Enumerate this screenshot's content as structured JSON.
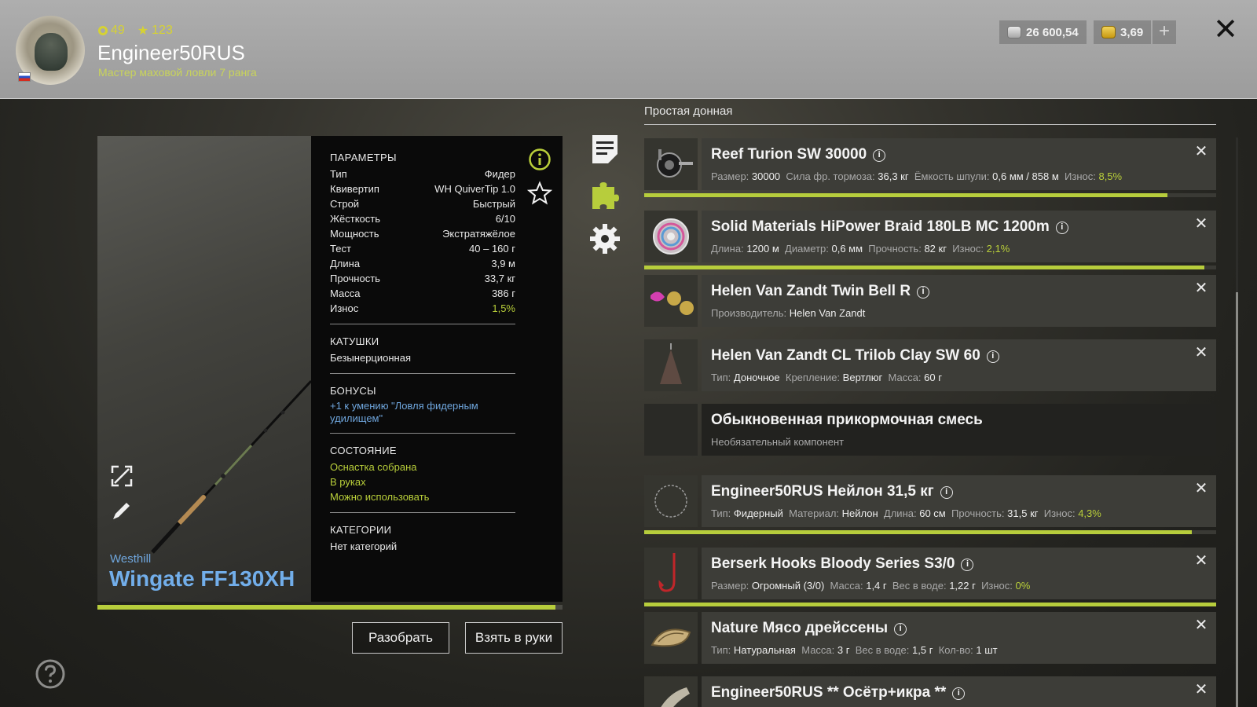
{
  "header": {
    "level": "49",
    "stars": "123",
    "username": "Engineer50RUS",
    "rank": "Мастер маховой ловли 7 ранга",
    "silver": "26 600,54",
    "gold": "3,69",
    "plus_label": "+",
    "close_label": "✕"
  },
  "rod": {
    "brand": "Westhill",
    "model": "Wingate FF130XH",
    "wear_fraction": 0.985
  },
  "params": {
    "title": "ПАРАМЕТРЫ",
    "rows": [
      {
        "label": "Тип",
        "value": "Фидер"
      },
      {
        "label": "Квивертип",
        "value": "WH QuiverTip 1.0"
      },
      {
        "label": "Строй",
        "value": "Быстрый"
      },
      {
        "label": "Жёсткость",
        "value": "6/10"
      },
      {
        "label": "Мощность",
        "value": "Экстратяжёлое"
      },
      {
        "label": "Тест",
        "value": "40 – 160 г"
      },
      {
        "label": "Длина",
        "value": "3,9 м"
      },
      {
        "label": "Прочность",
        "value": "33,7 кг"
      },
      {
        "label": "Масса",
        "value": "386 г"
      },
      {
        "label": "Износ",
        "value": "1,5%"
      }
    ],
    "reels_title": "КАТУШКИ",
    "reels_value": "Безынерционная",
    "bonus_title": "БОНУСЫ",
    "bonus_value": "+1 к умению \"Ловля фидерным удилищем\"",
    "state_title": "СОСТОЯНИЕ",
    "state_1": "Оснастка собрана",
    "state_2": "В руках",
    "state_3": "Можно использовать",
    "cat_title": "КАТЕГОРИИ",
    "cat_value": "Нет категорий"
  },
  "buttons": {
    "disassemble": "Разобрать",
    "take": "Взять в руки"
  },
  "rig": {
    "title": "Простая донная",
    "slots": [
      {
        "name": "Reef Turion SW 30000",
        "props": [
          [
            "Размер:",
            "30000"
          ],
          [
            "Сила фр. тормоза:",
            "36,3 кг"
          ],
          [
            "Ёмкость шпули:",
            "0,6 мм / 858 м"
          ]
        ],
        "wear_label": "Износ:",
        "wear": "8,5%",
        "durability": 0.915
      },
      {
        "name": "Solid Materials HiPower Braid 180LB MC 1200m",
        "props": [
          [
            "Длина:",
            "1200 м"
          ],
          [
            "Диаметр:",
            "0,6 мм"
          ],
          [
            "Прочность:",
            "82 кг"
          ]
        ],
        "wear_label": "Износ:",
        "wear": "2,1%",
        "durability": 0.979
      },
      {
        "name": "Helen Van Zandt Twin Bell R",
        "props": [
          [
            "Производитель:",
            "Helen Van Zandt"
          ]
        ]
      },
      {
        "name": "Helen Van Zandt CL Trilob Clay SW 60",
        "props": [
          [
            "Тип:",
            "Доночное"
          ],
          [
            "Крепление:",
            "Вертлюг"
          ],
          [
            "Масса:",
            "60 г"
          ]
        ]
      },
      {
        "name": "Обыкновенная прикормочная смесь",
        "subtitle": "Необязательный компонент"
      },
      {
        "name": "Engineer50RUS Нейлон 31,5 кг",
        "props": [
          [
            "Тип:",
            "Фидерный"
          ],
          [
            "Материал:",
            "Нейлон"
          ],
          [
            "Длина:",
            "60 см"
          ],
          [
            "Прочность:",
            "31,5 кг"
          ]
        ],
        "wear_label": "Износ:",
        "wear": "4,3%",
        "durability": 0.957
      },
      {
        "name": "Berserk Hooks Bloody Series S3/0",
        "props": [
          [
            "Размер:",
            "Огромный (3/0)"
          ],
          [
            "Масса:",
            "1,4 г"
          ],
          [
            "Вес в воде:",
            "1,22 г"
          ]
        ],
        "wear_label": "Износ:",
        "wear": "0%",
        "durability": 1.0
      },
      {
        "name": "Nature Мясо дрейссены",
        "props": [
          [
            "Тип:",
            "Натуральная"
          ],
          [
            "Масса:",
            "3 г"
          ],
          [
            "Вес в воде:",
            "1,5 г"
          ],
          [
            "Кол-во:",
            "1 шт"
          ]
        ]
      },
      {
        "name": "Engineer50RUS ** Осётр+икра **",
        "props": []
      }
    ]
  },
  "colors": {
    "accent_green": "#b9cf3a",
    "link_blue": "#6fa6dd"
  }
}
